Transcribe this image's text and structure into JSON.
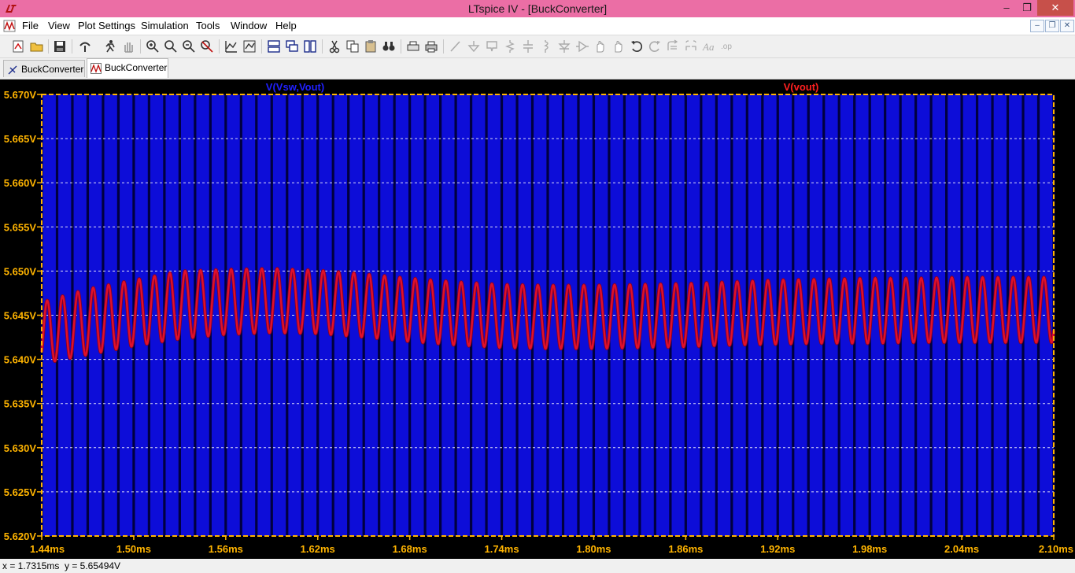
{
  "window": {
    "title": "LTspice IV - [BuckConverter]",
    "controls": {
      "minimize": "–",
      "maximize": "❐",
      "close": "✕"
    }
  },
  "menu": {
    "items": [
      "File",
      "View",
      "Plot Settings",
      "Simulation",
      "Tools",
      "Window",
      "Help"
    ],
    "mdi_controls": [
      "–",
      "❐",
      "✕"
    ]
  },
  "toolbar": {
    "icons": [
      "new-schematic-icon",
      "open-icon",
      "save-icon",
      "control-panel-icon",
      "run-icon",
      "halt-icon",
      "zoom-in-icon",
      "zoom-out-icon",
      "zoom-fit-icon",
      "zoom-cancel-icon",
      "autorange-icon",
      "pick-visible-traces-icon",
      "tile-horizontal-icon",
      "cascade-icon",
      "tile-vertical-icon",
      "cut-icon",
      "copy-icon",
      "paste-icon",
      "find-icon",
      "print-preview-icon",
      "print-icon",
      "wire-icon",
      "ground-icon",
      "label-icon",
      "resistor-icon",
      "capacitor-icon",
      "inductor-icon",
      "diode-icon",
      "component-icon",
      "move-icon",
      "drag-icon",
      "undo-icon",
      "redo-icon",
      "rotate-icon",
      "mirror-icon",
      "text-icon",
      "spice-directive-icon"
    ]
  },
  "tabs": [
    {
      "label": "BuckConverter",
      "icon": "schematic-icon",
      "active": false
    },
    {
      "label": "BuckConverter",
      "icon": "waveform-icon",
      "active": true
    }
  ],
  "plot": {
    "trace_labels": [
      {
        "text": "V(Vsw,Vout)",
        "color": "#2020ff"
      },
      {
        "text": "V(vout)",
        "color": "#ff2020"
      }
    ],
    "colors": {
      "background": "#000000",
      "frame": "#ffb400",
      "grid": "#ffffff",
      "axis_text": "#ffb400",
      "vsw_trace": "#0d0dd8",
      "vout_trace": "#e0102a",
      "vout_trace_dark": "#80002a"
    }
  },
  "chart_data": {
    "type": "line",
    "title": "",
    "xlabel": "",
    "ylabel": "",
    "xlim": [
      1.44,
      2.1
    ],
    "ylim": [
      5.62,
      5.67
    ],
    "x_unit": "ms",
    "y_unit": "V",
    "x_ticks": [
      "1.44ms",
      "1.50ms",
      "1.56ms",
      "1.62ms",
      "1.68ms",
      "1.74ms",
      "1.80ms",
      "1.86ms",
      "1.92ms",
      "1.98ms",
      "2.04ms",
      "2.10ms"
    ],
    "y_ticks": [
      "5.670V",
      "5.665V",
      "5.660V",
      "5.655V",
      "5.650V",
      "5.645V",
      "5.640V",
      "5.635V",
      "5.630V",
      "5.625V",
      "5.620V"
    ],
    "grid": true,
    "legend": "top",
    "series": [
      {
        "name": "V(Vsw,Vout)",
        "kind": "switching square wave, off-scale (fills plot area)",
        "switching_period_ms": 0.01
      },
      {
        "name": "V(vout)",
        "kind": "output ripple",
        "ripple_period_ms": 0.01,
        "x": [
          1.44,
          1.47,
          1.5,
          1.53,
          1.56,
          1.59,
          1.62,
          1.65,
          1.68,
          1.71,
          1.74,
          1.77,
          1.8,
          1.83,
          1.86,
          1.89,
          1.92,
          1.95,
          1.98,
          2.01,
          2.04,
          2.07,
          2.1
        ],
        "max": [
          5.6465,
          5.648,
          5.649,
          5.65,
          5.6502,
          5.6503,
          5.6501,
          5.6497,
          5.6492,
          5.6488,
          5.6485,
          5.6484,
          5.6484,
          5.6485,
          5.6486,
          5.6488,
          5.649,
          5.6491,
          5.6492,
          5.6492,
          5.6493,
          5.6493,
          5.6493
        ],
        "min": [
          5.6395,
          5.6405,
          5.6415,
          5.6423,
          5.6428,
          5.643,
          5.6429,
          5.6425,
          5.642,
          5.6416,
          5.6413,
          5.6412,
          5.6412,
          5.6413,
          5.6414,
          5.6416,
          5.6417,
          5.6418,
          5.6418,
          5.6419,
          5.6419,
          5.6419,
          5.6419
        ]
      }
    ]
  },
  "status": {
    "x": "x = 1.7315ms",
    "y": "y = 5.65494V"
  }
}
